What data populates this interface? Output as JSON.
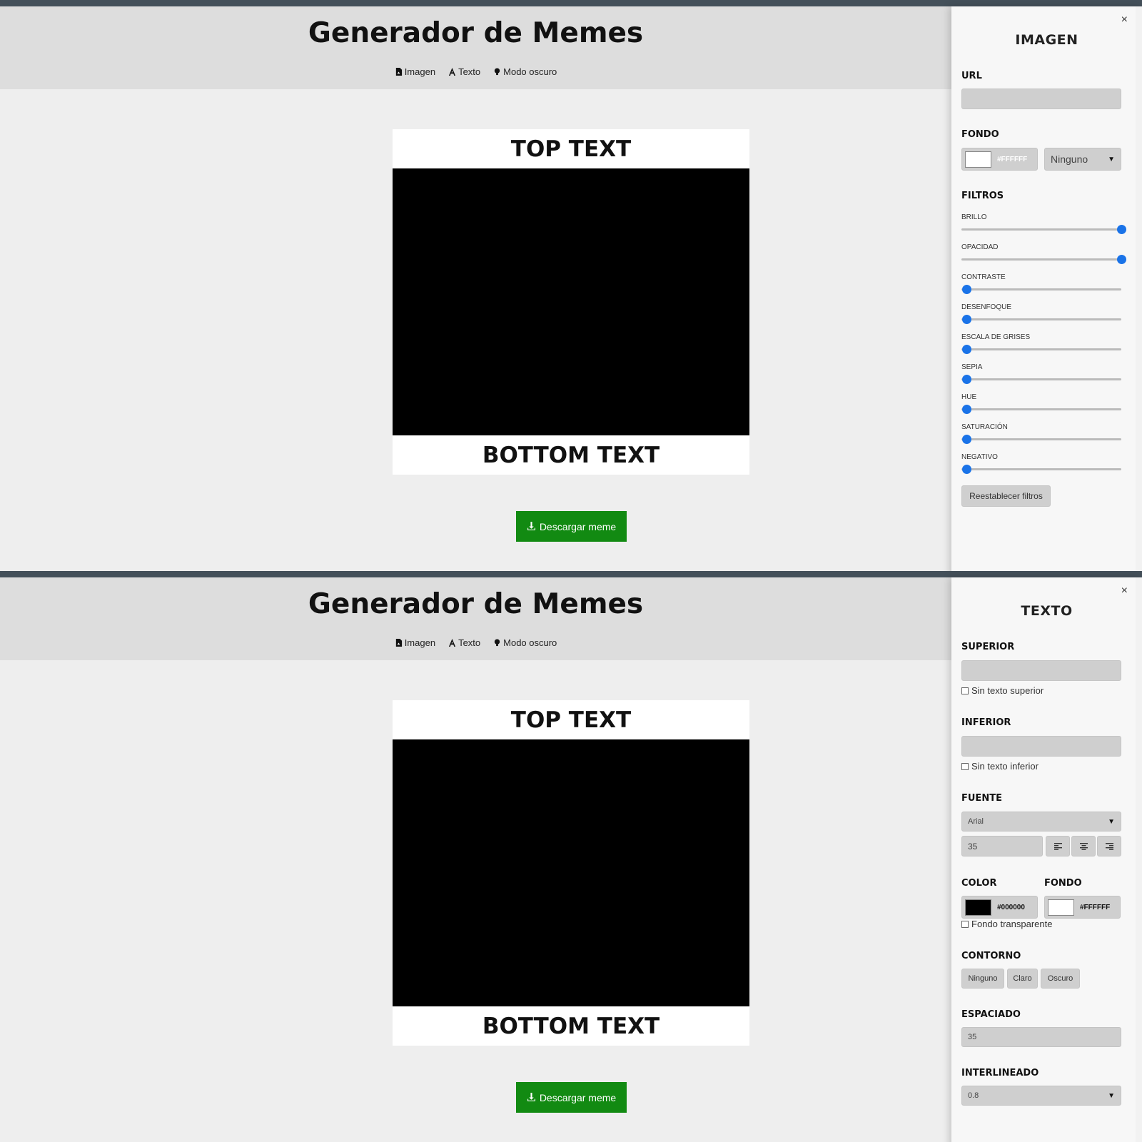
{
  "app": {
    "title": "Generador de Memes",
    "nav": [
      {
        "label": "Imagen",
        "icon": "image-file-icon"
      },
      {
        "label": "Texto",
        "icon": "text-font-icon"
      },
      {
        "label": "Modo oscuro",
        "icon": "lightbulb-icon"
      }
    ]
  },
  "meme": {
    "top_text": "TOP TEXT",
    "bottom_text": "BOTTOM TEXT"
  },
  "download": {
    "label": "Descargar meme",
    "icon": "download-icon"
  },
  "image_panel": {
    "title": "IMAGEN",
    "close": "×",
    "url_label": "URL",
    "url_value": "",
    "background_label": "FONDO",
    "background_color": "#FFFFFF",
    "blend_mode": "Ninguno",
    "filters_label": "FILTROS",
    "filters": [
      {
        "label": "BRILLO",
        "value": 1
      },
      {
        "label": "OPACIDAD",
        "value": 1
      },
      {
        "label": "CONTRASTE",
        "value": 0
      },
      {
        "label": "DESENFOQUE",
        "value": 0
      },
      {
        "label": "ESCALA DE GRISES",
        "value": 0
      },
      {
        "label": "SEPIA",
        "value": 0
      },
      {
        "label": "HUE",
        "value": 0
      },
      {
        "label": "SATURACIÓN",
        "value": 0
      },
      {
        "label": "NEGATIVO",
        "value": 0
      }
    ],
    "reset_label": "Reestablecer filtros"
  },
  "text_panel": {
    "title": "TEXTO",
    "close": "×",
    "top_label": "SUPERIOR",
    "top_value": "",
    "no_top_label": "Sin texto superior",
    "bottom_label": "INFERIOR",
    "bottom_value": "",
    "no_bottom_label": "Sin texto inferior",
    "font_label": "FUENTE",
    "font_value": "Arial",
    "font_size": "35",
    "align_left_icon": "align-left-icon",
    "align_center_icon": "align-center-icon",
    "align_right_icon": "align-right-icon",
    "color_label": "COLOR",
    "color_value": "#000000",
    "bg_label": "FONDO",
    "bg_value": "#FFFFFF",
    "transparent_label": "Fondo transparente",
    "outline_label": "CONTORNO",
    "outline_options": [
      "Ninguno",
      "Claro",
      "Oscuro"
    ],
    "spacing_label": "ESPACIADO",
    "spacing_value": "35",
    "line_height_label": "INTERLINEADO",
    "line_height_value": "0.8"
  },
  "colors": {
    "accent": "#1a73e8",
    "download_button": "#128a12",
    "header_bg": "#dddddd",
    "page_bg": "#eeeeee"
  }
}
